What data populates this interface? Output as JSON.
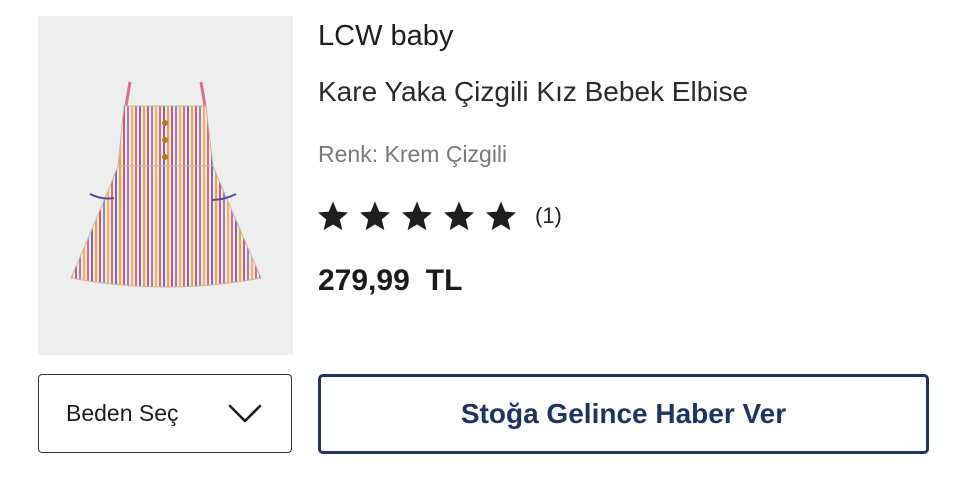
{
  "product": {
    "image_alt": "striped baby dress",
    "brand": "LCW baby",
    "name": "Kare Yaka Çizgili Kız Bebek Elbise",
    "color_line": "Renk: Krem Çizgili",
    "rating": {
      "stars": 5,
      "max": 5,
      "review_count": "(1)",
      "star_color": "#1e1e1e"
    },
    "price": {
      "amount": "279,99",
      "currency": "TL"
    }
  },
  "actions": {
    "size_select_label": "Beden Seç",
    "notify_button_label": "Stoğa Gelince Haber Ver",
    "notify_color": "#1e3561"
  },
  "icons": {
    "chevron": "chevron-down-icon",
    "star": "star-icon"
  }
}
